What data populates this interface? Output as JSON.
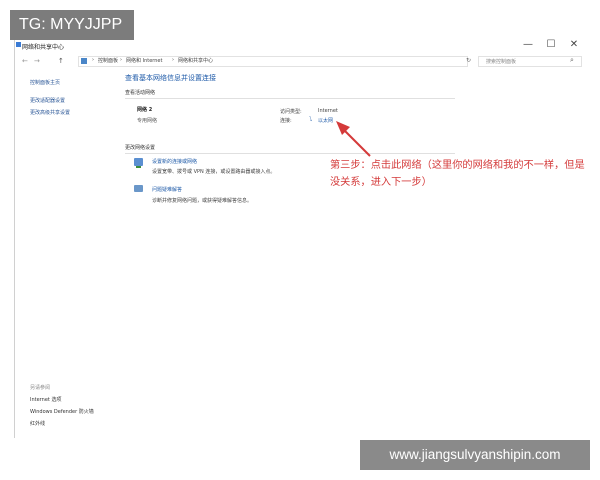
{
  "badge": {
    "text": "TG: MYYJJPP"
  },
  "window": {
    "title": "网络和共享中心",
    "controls": {
      "minimize": "—",
      "maximize": "☐",
      "close": "✕"
    }
  },
  "address_bar": {
    "back": "←",
    "forward": "→",
    "up": "↑",
    "breadcrumbs": [
      "控制面板",
      "网络和 Internet",
      "网络和共享中心"
    ],
    "separator": "›",
    "refresh": "↻",
    "search_placeholder": "搜索控制面板",
    "search_icon": "search-icon"
  },
  "sidebar": {
    "items": [
      {
        "label": "控制面板主页"
      },
      {
        "label": "更改适配器设置"
      },
      {
        "label": "更改高级共享设置"
      }
    ],
    "see_also_title": "另请参阅",
    "see_also": [
      {
        "label": "Internet 选项"
      },
      {
        "label": "Windows Defender 防火墙"
      },
      {
        "label": "红外线"
      }
    ]
  },
  "main": {
    "title": "查看基本网络信息并设置连接",
    "active_section_label": "查看活动网络",
    "network": {
      "name": "网络 2",
      "type": "专用网络",
      "access_type_label": "访问类型:",
      "access_type_value": "Internet",
      "connection_label": "连接:",
      "connection_value": "以太网"
    },
    "change_section_label": "更改网络设置",
    "options": [
      {
        "link": "设置新的连接或网络",
        "desc": "设置宽带、拨号或 VPN 连接，或设置路由器或接入点。"
      },
      {
        "link": "问题疑难解答",
        "desc": "诊断并修复网络问题，或获得疑难解答信息。"
      }
    ]
  },
  "annotation": {
    "text": "第三步：点击此网络（这里你的网络和我的不一样，但是没关系，进入下一步）",
    "color": "#d43a3a"
  },
  "watermark": {
    "text": "www.jiangsulvyanshipin.com"
  }
}
